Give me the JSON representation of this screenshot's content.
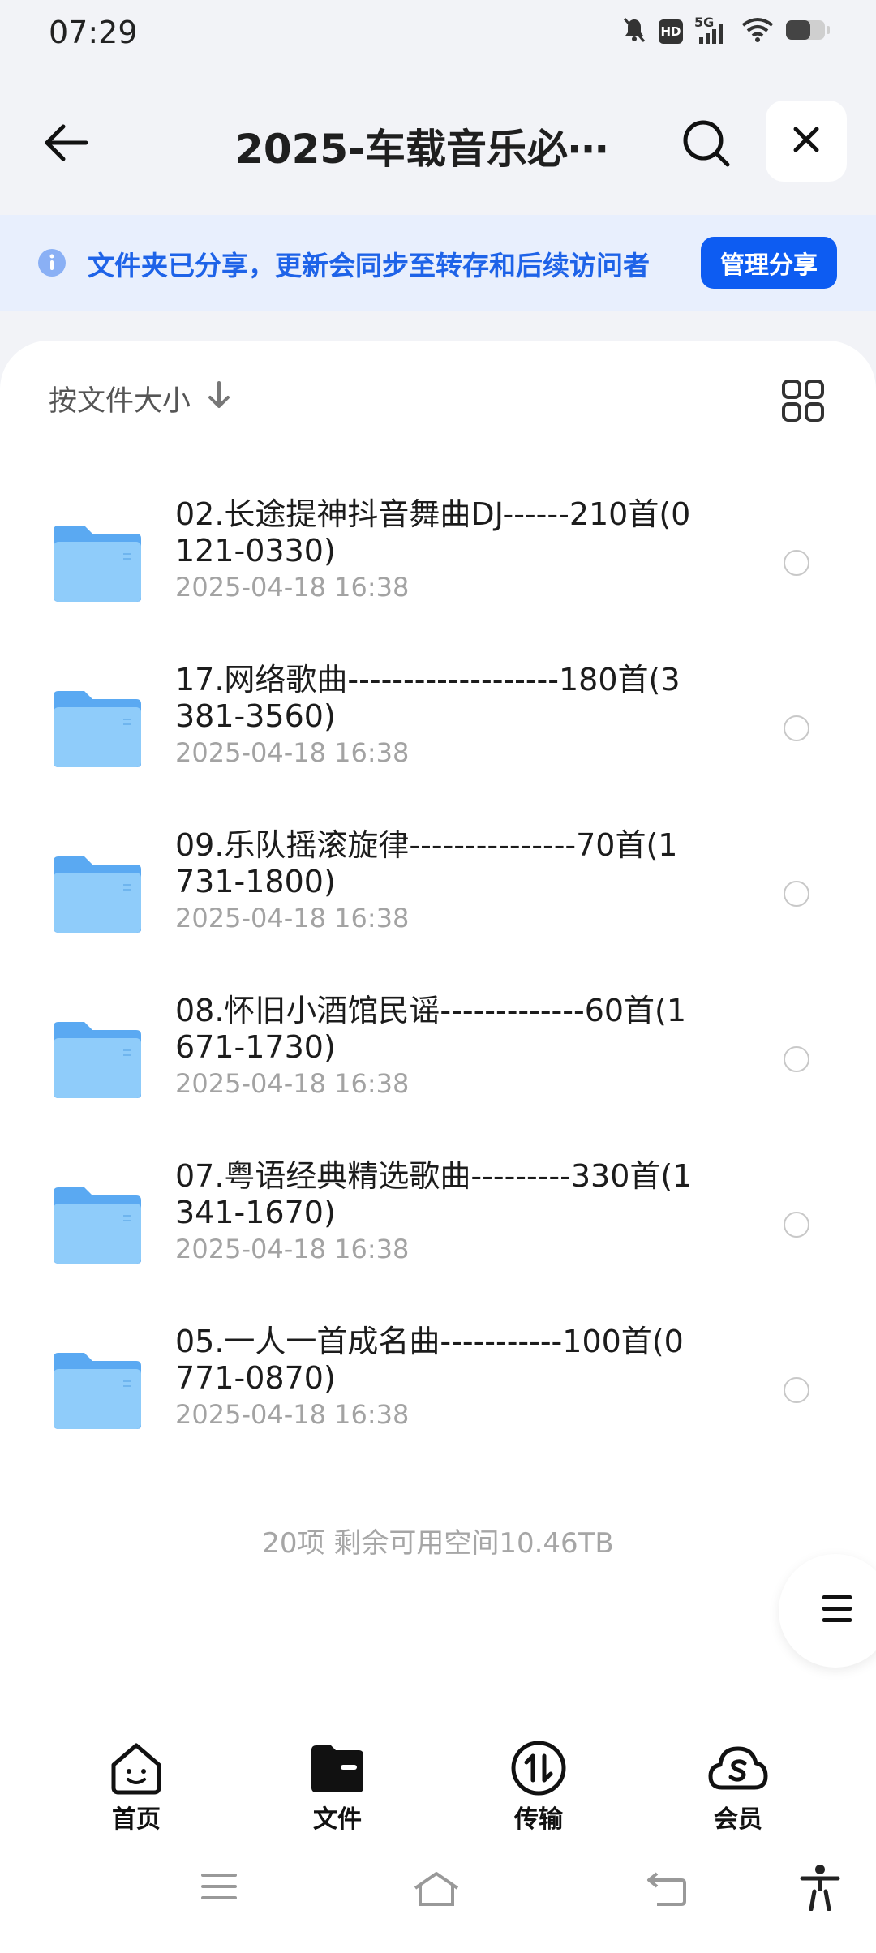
{
  "status_bar": {
    "time": "07:29",
    "icons": [
      "mute-icon",
      "hd-icon",
      "signal-5g-icon",
      "wifi-icon",
      "battery-icon"
    ],
    "network_label": "5G",
    "hd_label": "HD"
  },
  "header": {
    "title": "2025-车载音乐必⋯",
    "icons": [
      "back-arrow-icon",
      "search-icon",
      "close-icon"
    ]
  },
  "banner": {
    "text": "文件夹已分享，更新会同步至转存和后续访问者",
    "button_label": "管理分享",
    "icon": "info-icon",
    "accent": "#1e63e8"
  },
  "sort": {
    "label": "按文件大小",
    "icon": "arrow-down-icon"
  },
  "view_toggle": {
    "icon": "grid-view-icon"
  },
  "files": [
    {
      "name": "02.长途提神抖音舞曲DJ------210首(0121-0330)",
      "date": "2025-04-18 16:38"
    },
    {
      "name": "17.网络歌曲-------------------180首(3381-3560)",
      "date": "2025-04-18 16:38"
    },
    {
      "name": "09.乐队摇滚旋律---------------70首(1731-1800)",
      "date": "2025-04-18 16:38"
    },
    {
      "name": "08.怀旧小酒馆民谣-------------60首(1671-1730)",
      "date": "2025-04-18 16:38"
    },
    {
      "name": "07.粤语经典精选歌曲---------330首(1341-1670)",
      "date": "2025-04-18 16:38"
    },
    {
      "name": "05.一人一首成名曲-----------100首(0771-0870)",
      "date": "2025-04-18 16:38"
    }
  ],
  "footer": {
    "summary": "20项 剩余可用空间10.46TB"
  },
  "bottom_nav": [
    {
      "label": "首页",
      "icon": "home-face-icon"
    },
    {
      "label": "文件",
      "icon": "files-icon"
    },
    {
      "label": "传输",
      "icon": "transfer-icon"
    },
    {
      "label": "会员",
      "icon": "vip-cloud-icon"
    }
  ],
  "system_nav": [
    "menu-icon",
    "home-icon",
    "back-icon",
    "accessibility-icon"
  ],
  "colors": {
    "folder": "#6cb6f7",
    "primary_button": "#0d5cf2",
    "banner_bg": "#e8effd"
  }
}
